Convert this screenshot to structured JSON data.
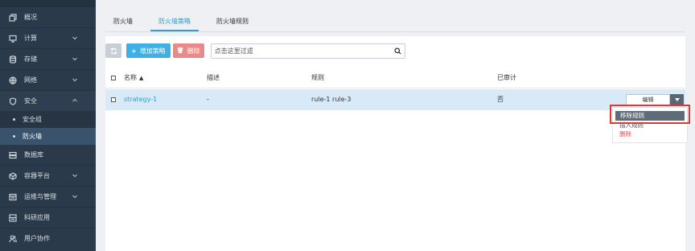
{
  "sidebar": {
    "items": [
      {
        "label": "概况",
        "icon": "overview-icon",
        "expandable": false
      },
      {
        "label": "计算",
        "icon": "monitor-icon",
        "expandable": true
      },
      {
        "label": "存储",
        "icon": "database-icon",
        "expandable": true
      },
      {
        "label": "网络",
        "icon": "globe-icon",
        "expandable": true
      },
      {
        "label": "安全",
        "icon": "shield-icon",
        "expandable": true,
        "expanded": true
      }
    ],
    "sub_items": [
      {
        "label": "安全组"
      },
      {
        "label": "防火墙",
        "active": true
      }
    ],
    "items_after": [
      {
        "label": "数据库",
        "icon": "server-icon",
        "expandable": false
      },
      {
        "label": "容器平台",
        "icon": "container-icon",
        "expandable": true
      },
      {
        "label": "运维与管理",
        "icon": "ops-icon",
        "expandable": true
      },
      {
        "label": "科研应用",
        "icon": "app-icon",
        "expandable": false
      },
      {
        "label": "用户协作",
        "icon": "users-icon",
        "expandable": false
      }
    ]
  },
  "tabs": [
    {
      "label": "防火墙"
    },
    {
      "label": "防火墙策略",
      "active": true
    },
    {
      "label": "防火墙规则"
    }
  ],
  "toolbar": {
    "add_label": "增加策略",
    "delete_label": "删除",
    "search_placeholder": "点击这里过滤"
  },
  "table": {
    "headers": {
      "name": "名称",
      "desc": "描述",
      "rules": "规则",
      "audited": "已审计"
    },
    "rows": [
      {
        "name": "strategy-1",
        "desc": "-",
        "rules": "rule-1  rule-3",
        "audited": "否",
        "action": "编辑"
      }
    ]
  },
  "dropdown": {
    "items": [
      "移除规则",
      "插入规则",
      "删除"
    ]
  },
  "colors": {
    "accent": "#2a9fd6",
    "sidebar_bg": "#2b3a4a",
    "danger": "#d9534f",
    "highlight_box": "#d93a32"
  }
}
